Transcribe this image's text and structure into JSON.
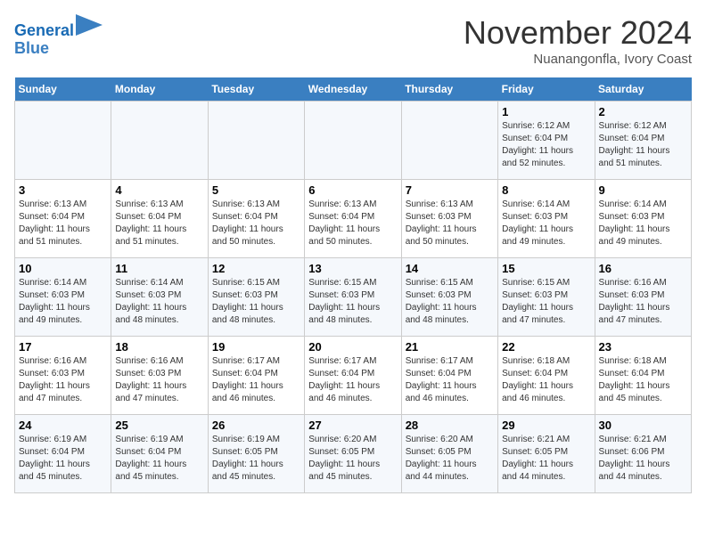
{
  "header": {
    "logo_line1": "General",
    "logo_line2": "Blue",
    "month": "November 2024",
    "location": "Nuanangonfla, Ivory Coast"
  },
  "weekdays": [
    "Sunday",
    "Monday",
    "Tuesday",
    "Wednesday",
    "Thursday",
    "Friday",
    "Saturday"
  ],
  "weeks": [
    [
      {
        "day": "",
        "info": ""
      },
      {
        "day": "",
        "info": ""
      },
      {
        "day": "",
        "info": ""
      },
      {
        "day": "",
        "info": ""
      },
      {
        "day": "",
        "info": ""
      },
      {
        "day": "1",
        "info": "Sunrise: 6:12 AM\nSunset: 6:04 PM\nDaylight: 11 hours\nand 52 minutes."
      },
      {
        "day": "2",
        "info": "Sunrise: 6:12 AM\nSunset: 6:04 PM\nDaylight: 11 hours\nand 51 minutes."
      }
    ],
    [
      {
        "day": "3",
        "info": "Sunrise: 6:13 AM\nSunset: 6:04 PM\nDaylight: 11 hours\nand 51 minutes."
      },
      {
        "day": "4",
        "info": "Sunrise: 6:13 AM\nSunset: 6:04 PM\nDaylight: 11 hours\nand 51 minutes."
      },
      {
        "day": "5",
        "info": "Sunrise: 6:13 AM\nSunset: 6:04 PM\nDaylight: 11 hours\nand 50 minutes."
      },
      {
        "day": "6",
        "info": "Sunrise: 6:13 AM\nSunset: 6:04 PM\nDaylight: 11 hours\nand 50 minutes."
      },
      {
        "day": "7",
        "info": "Sunrise: 6:13 AM\nSunset: 6:03 PM\nDaylight: 11 hours\nand 50 minutes."
      },
      {
        "day": "8",
        "info": "Sunrise: 6:14 AM\nSunset: 6:03 PM\nDaylight: 11 hours\nand 49 minutes."
      },
      {
        "day": "9",
        "info": "Sunrise: 6:14 AM\nSunset: 6:03 PM\nDaylight: 11 hours\nand 49 minutes."
      }
    ],
    [
      {
        "day": "10",
        "info": "Sunrise: 6:14 AM\nSunset: 6:03 PM\nDaylight: 11 hours\nand 49 minutes."
      },
      {
        "day": "11",
        "info": "Sunrise: 6:14 AM\nSunset: 6:03 PM\nDaylight: 11 hours\nand 48 minutes."
      },
      {
        "day": "12",
        "info": "Sunrise: 6:15 AM\nSunset: 6:03 PM\nDaylight: 11 hours\nand 48 minutes."
      },
      {
        "day": "13",
        "info": "Sunrise: 6:15 AM\nSunset: 6:03 PM\nDaylight: 11 hours\nand 48 minutes."
      },
      {
        "day": "14",
        "info": "Sunrise: 6:15 AM\nSunset: 6:03 PM\nDaylight: 11 hours\nand 48 minutes."
      },
      {
        "day": "15",
        "info": "Sunrise: 6:15 AM\nSunset: 6:03 PM\nDaylight: 11 hours\nand 47 minutes."
      },
      {
        "day": "16",
        "info": "Sunrise: 6:16 AM\nSunset: 6:03 PM\nDaylight: 11 hours\nand 47 minutes."
      }
    ],
    [
      {
        "day": "17",
        "info": "Sunrise: 6:16 AM\nSunset: 6:03 PM\nDaylight: 11 hours\nand 47 minutes."
      },
      {
        "day": "18",
        "info": "Sunrise: 6:16 AM\nSunset: 6:03 PM\nDaylight: 11 hours\nand 47 minutes."
      },
      {
        "day": "19",
        "info": "Sunrise: 6:17 AM\nSunset: 6:04 PM\nDaylight: 11 hours\nand 46 minutes."
      },
      {
        "day": "20",
        "info": "Sunrise: 6:17 AM\nSunset: 6:04 PM\nDaylight: 11 hours\nand 46 minutes."
      },
      {
        "day": "21",
        "info": "Sunrise: 6:17 AM\nSunset: 6:04 PM\nDaylight: 11 hours\nand 46 minutes."
      },
      {
        "day": "22",
        "info": "Sunrise: 6:18 AM\nSunset: 6:04 PM\nDaylight: 11 hours\nand 46 minutes."
      },
      {
        "day": "23",
        "info": "Sunrise: 6:18 AM\nSunset: 6:04 PM\nDaylight: 11 hours\nand 45 minutes."
      }
    ],
    [
      {
        "day": "24",
        "info": "Sunrise: 6:19 AM\nSunset: 6:04 PM\nDaylight: 11 hours\nand 45 minutes."
      },
      {
        "day": "25",
        "info": "Sunrise: 6:19 AM\nSunset: 6:04 PM\nDaylight: 11 hours\nand 45 minutes."
      },
      {
        "day": "26",
        "info": "Sunrise: 6:19 AM\nSunset: 6:05 PM\nDaylight: 11 hours\nand 45 minutes."
      },
      {
        "day": "27",
        "info": "Sunrise: 6:20 AM\nSunset: 6:05 PM\nDaylight: 11 hours\nand 45 minutes."
      },
      {
        "day": "28",
        "info": "Sunrise: 6:20 AM\nSunset: 6:05 PM\nDaylight: 11 hours\nand 44 minutes."
      },
      {
        "day": "29",
        "info": "Sunrise: 6:21 AM\nSunset: 6:05 PM\nDaylight: 11 hours\nand 44 minutes."
      },
      {
        "day": "30",
        "info": "Sunrise: 6:21 AM\nSunset: 6:06 PM\nDaylight: 11 hours\nand 44 minutes."
      }
    ]
  ]
}
